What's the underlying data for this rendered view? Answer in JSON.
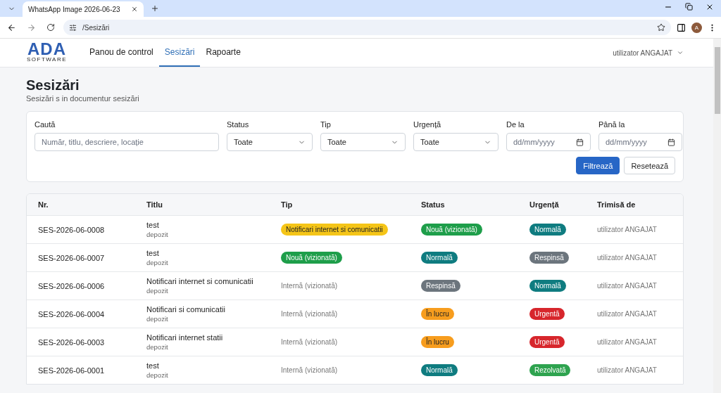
{
  "browser": {
    "tab_title": "WhatsApp Image 2026-06-23",
    "url": "/Sesizări",
    "profile_initial": "A"
  },
  "header": {
    "logo_main": "ADA",
    "logo_sub": "SOFTWARE",
    "nav": [
      {
        "label": "Panou de control",
        "selected": false
      },
      {
        "label": "Sesizări",
        "selected": true
      },
      {
        "label": "Rapoarte",
        "selected": false
      }
    ],
    "user": "utilizator ANGAJAT"
  },
  "page": {
    "title": "Sesizări",
    "subtitle": "Sesizări s in documentur sesizări"
  },
  "filters": {
    "search": {
      "label": "Caută",
      "placeholder": "Număr, titlu, descriere, locație"
    },
    "selects": [
      {
        "label": "Status",
        "value": "Toate"
      },
      {
        "label": "Tip",
        "value": "Toate"
      },
      {
        "label": "Urgență",
        "value": "Toate"
      }
    ],
    "dates": [
      {
        "label": "De la",
        "placeholder": "dd/mm/yyyy"
      },
      {
        "label": "Până la",
        "placeholder": "dd/mm/yyyy"
      }
    ],
    "buttons": [
      {
        "label": "Filtrează",
        "kind": "primary"
      },
      {
        "label": "Resetează",
        "kind": "secondary"
      }
    ]
  },
  "table": {
    "columns": [
      "Nr.",
      "Titlu",
      "Tip",
      "Status",
      "Urgență",
      "Trimisă de"
    ],
    "rows": [
      {
        "nr": "SES-2026-06-0008",
        "title": "test",
        "location": "depozit",
        "type": {
          "kind": "badge",
          "text": "Notificari internet si comunicatii",
          "color": "#f5c518"
        },
        "status": {
          "text": "Nouă (vizionată)",
          "color": "#1e9e4a"
        },
        "urgency": {
          "text": "Normală",
          "color": "#0f7c80"
        },
        "sender": "utilizator ANGAJAT"
      },
      {
        "nr": "SES-2026-06-0007",
        "title": "test",
        "location": "depozit",
        "type": {
          "kind": "badge",
          "text": "Nouă (vizionată)",
          "color": "#1e9e4a"
        },
        "status": {
          "text": "Normală",
          "color": "#0f7c80"
        },
        "urgency": {
          "text": "Respinsă",
          "color": "#6c757d"
        },
        "sender": "utilizator ANGAJAT"
      },
      {
        "nr": "SES-2026-06-0006",
        "title": "Notificari internet si comunicatii",
        "location": "depozit",
        "type": {
          "kind": "text",
          "text": "Internă (vizionată)"
        },
        "status": {
          "text": "Respinsă",
          "color": "#6c757d"
        },
        "urgency": {
          "text": "Normală",
          "color": "#0f7c80"
        },
        "sender": "utilizator ANGAJAT"
      },
      {
        "nr": "SES-2026-06-0004",
        "title": "Notificari si comunicatii",
        "location": "depozit",
        "type": {
          "kind": "text",
          "text": "Internă (vizionată)"
        },
        "status": {
          "text": "În lucru",
          "color": "#f79d1e"
        },
        "urgency": {
          "text": "Urgentă",
          "color": "#d7262c"
        },
        "sender": "utilizator ANGAJAT"
      },
      {
        "nr": "SES-2026-06-0003",
        "title": "Notificari internet statii",
        "location": "depozit",
        "type": {
          "kind": "text",
          "text": "Internă (vizionată)"
        },
        "status": {
          "text": "În lucru",
          "color": "#f79d1e"
        },
        "urgency": {
          "text": "Urgentă",
          "color": "#d7262c"
        },
        "sender": "utilizator ANGAJAT"
      },
      {
        "nr": "SES-2026-06-0001",
        "title": "test",
        "location": "depozit",
        "type": {
          "kind": "text",
          "text": "Internă (vizionată)"
        },
        "status": {
          "text": "Normală",
          "color": "#0f7c80"
        },
        "urgency": {
          "text": "Rezolvată",
          "color": "#2ea34f"
        },
        "sender": "utilizator ANGAJAT"
      }
    ]
  }
}
